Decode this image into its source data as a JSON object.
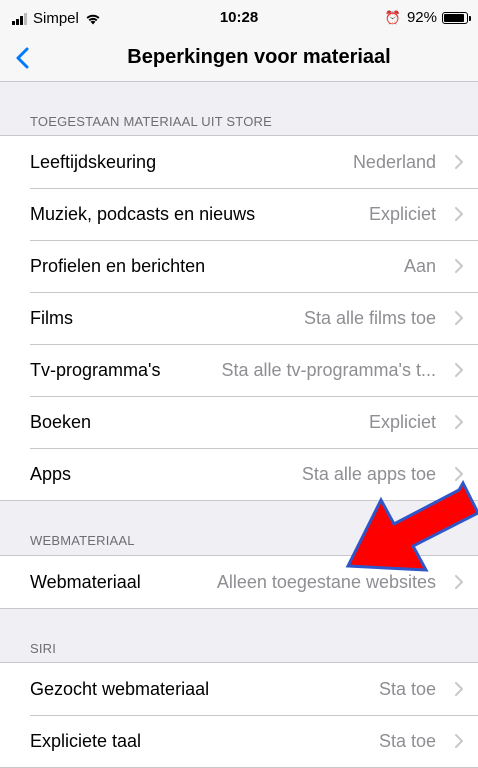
{
  "status_bar": {
    "carrier": "Simpel",
    "time": "10:28",
    "battery_percent": "92%",
    "battery_level": 0.92,
    "icons": [
      "signal-icon",
      "wifi-icon",
      "alarm-icon",
      "battery-icon"
    ]
  },
  "nav": {
    "title": "Beperkingen voor materiaal",
    "back_icon": "chevron-left-icon",
    "accent_color": "#007aff"
  },
  "sections": [
    {
      "header": "TOEGESTAAN MATERIAAL UIT STORE",
      "rows": [
        {
          "label": "Leeftijdskeuring",
          "value": "Nederland"
        },
        {
          "label": "Muziek, podcasts en nieuws",
          "value": "Expliciet"
        },
        {
          "label": "Profielen en berichten",
          "value": "Aan"
        },
        {
          "label": "Films",
          "value": "Sta alle films toe"
        },
        {
          "label": "Tv-programma's",
          "value": "Sta alle tv-programma's t..."
        },
        {
          "label": "Boeken",
          "value": "Expliciet"
        },
        {
          "label": "Apps",
          "value": "Sta alle apps toe"
        }
      ]
    },
    {
      "header": "WEBMATERIAAL",
      "rows": [
        {
          "label": "Webmateriaal",
          "value": "Alleen toegestane websites"
        }
      ]
    },
    {
      "header": "SIRI",
      "rows": [
        {
          "label": "Gezocht webmateriaal",
          "value": "Sta toe"
        },
        {
          "label": "Expliciete taal",
          "value": "Sta toe"
        }
      ]
    }
  ],
  "annotation": {
    "type": "red-arrow-icon",
    "fill_color": "#ff0000",
    "outline_color": "#2f56c8"
  }
}
